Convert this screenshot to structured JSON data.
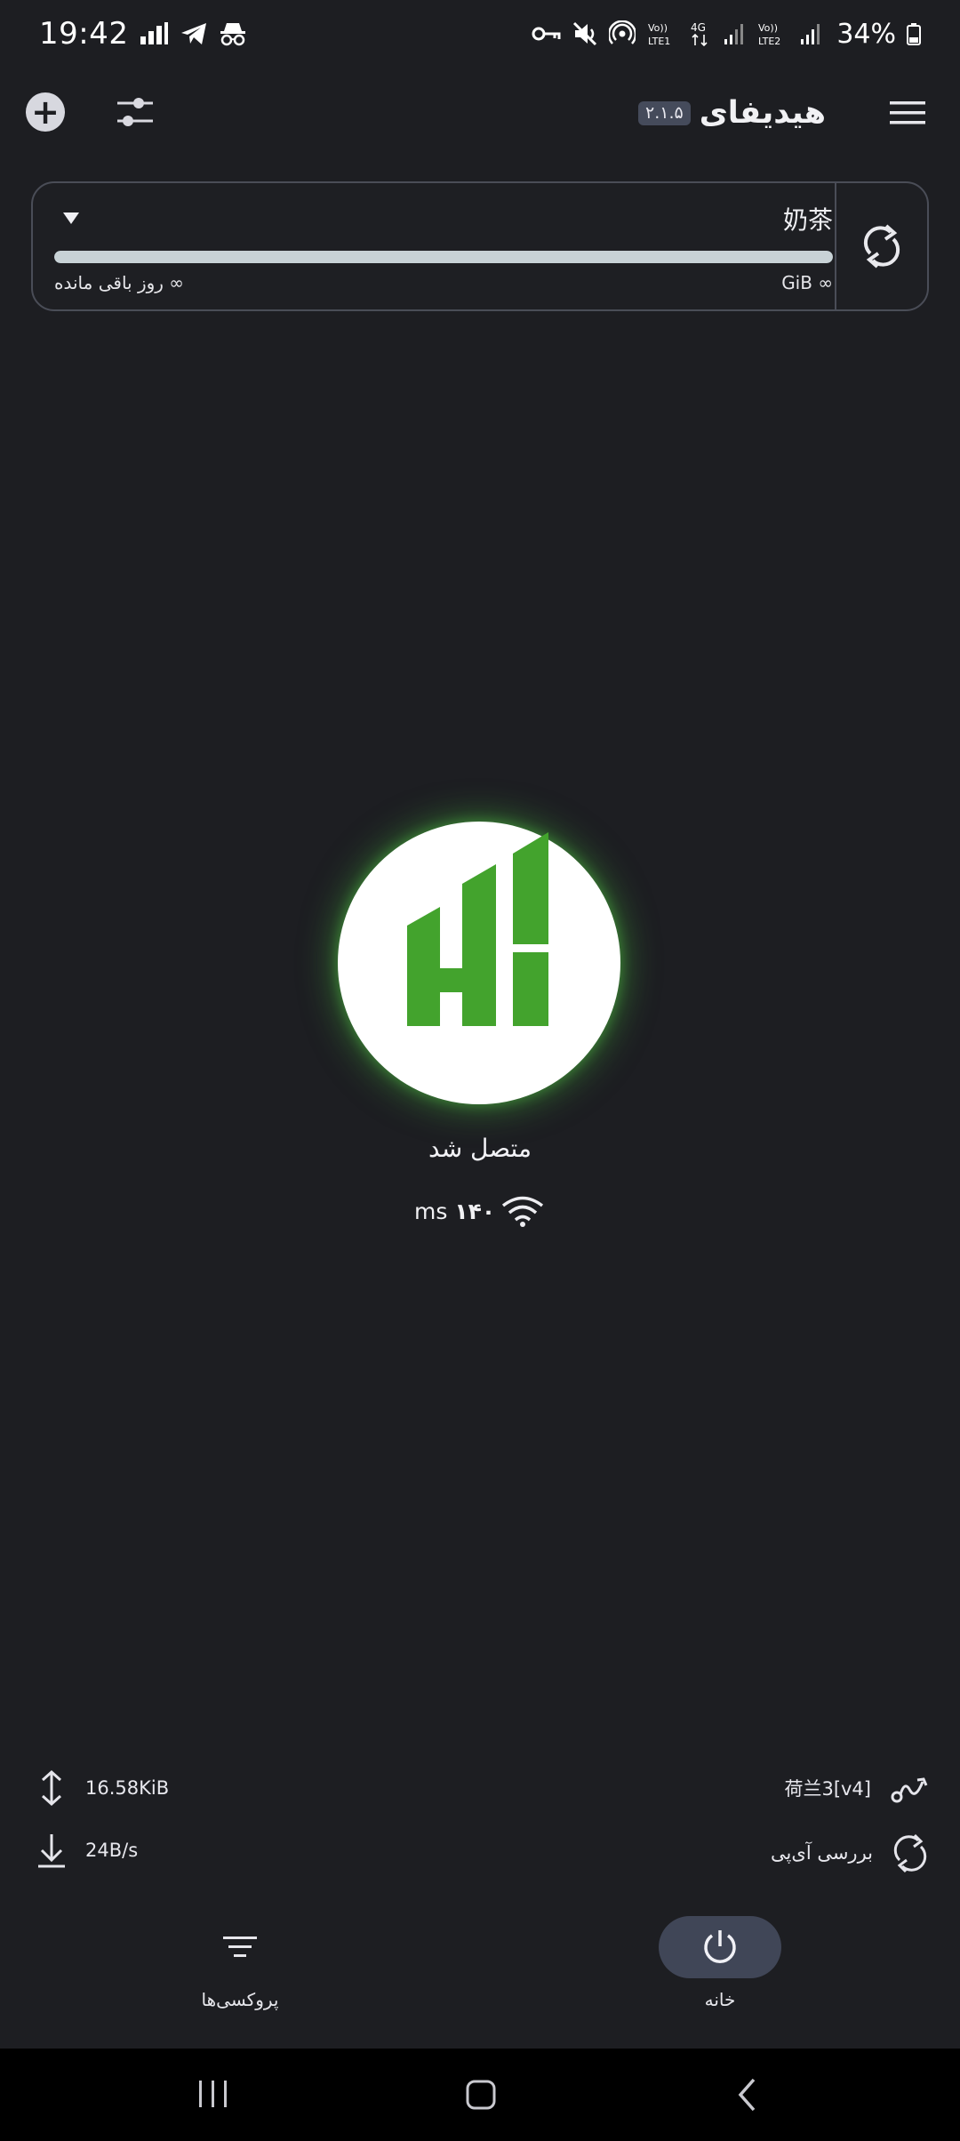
{
  "status_bar": {
    "time": "19:42",
    "battery": "34%",
    "icons": [
      "signal-bars-icon",
      "telegram-icon",
      "incognito-icon",
      "vpn-key-icon",
      "mute-icon",
      "hotspot-icon",
      "volte-lte1-icon",
      "4g-icon",
      "volte-lte2-icon",
      "battery-icon"
    ],
    "lte1": "LTE1",
    "lte2": "LTE2"
  },
  "header": {
    "title": "هیدیفای",
    "version": "۲.۱.۵",
    "icons": [
      "add-icon",
      "filter-icon",
      "menu-icon"
    ]
  },
  "profile": {
    "name": "奶茶",
    "remaining_days": "∞ روز باقی مانده",
    "remaining_data": "∞ GiB",
    "usage_fraction": 1.0
  },
  "connection": {
    "status": "متصل شد",
    "ping_unit": "ms",
    "ping_value": "۱۴۰",
    "accent": "#43a32d"
  },
  "stats": {
    "upload": "16.58KiB",
    "download": "24B/s",
    "server": "荷兰3[v4]",
    "check_ip": "بررسی آی‌پی"
  },
  "bottom_nav": {
    "proxies_label": "پروکسی‌ها",
    "home_label": "خانه",
    "active": "home"
  },
  "colors": {
    "background": "#1d1e22",
    "card_border": "#4a4d57",
    "usage_bar": "#c8d2d6",
    "nav_active_bg": "#404657"
  }
}
